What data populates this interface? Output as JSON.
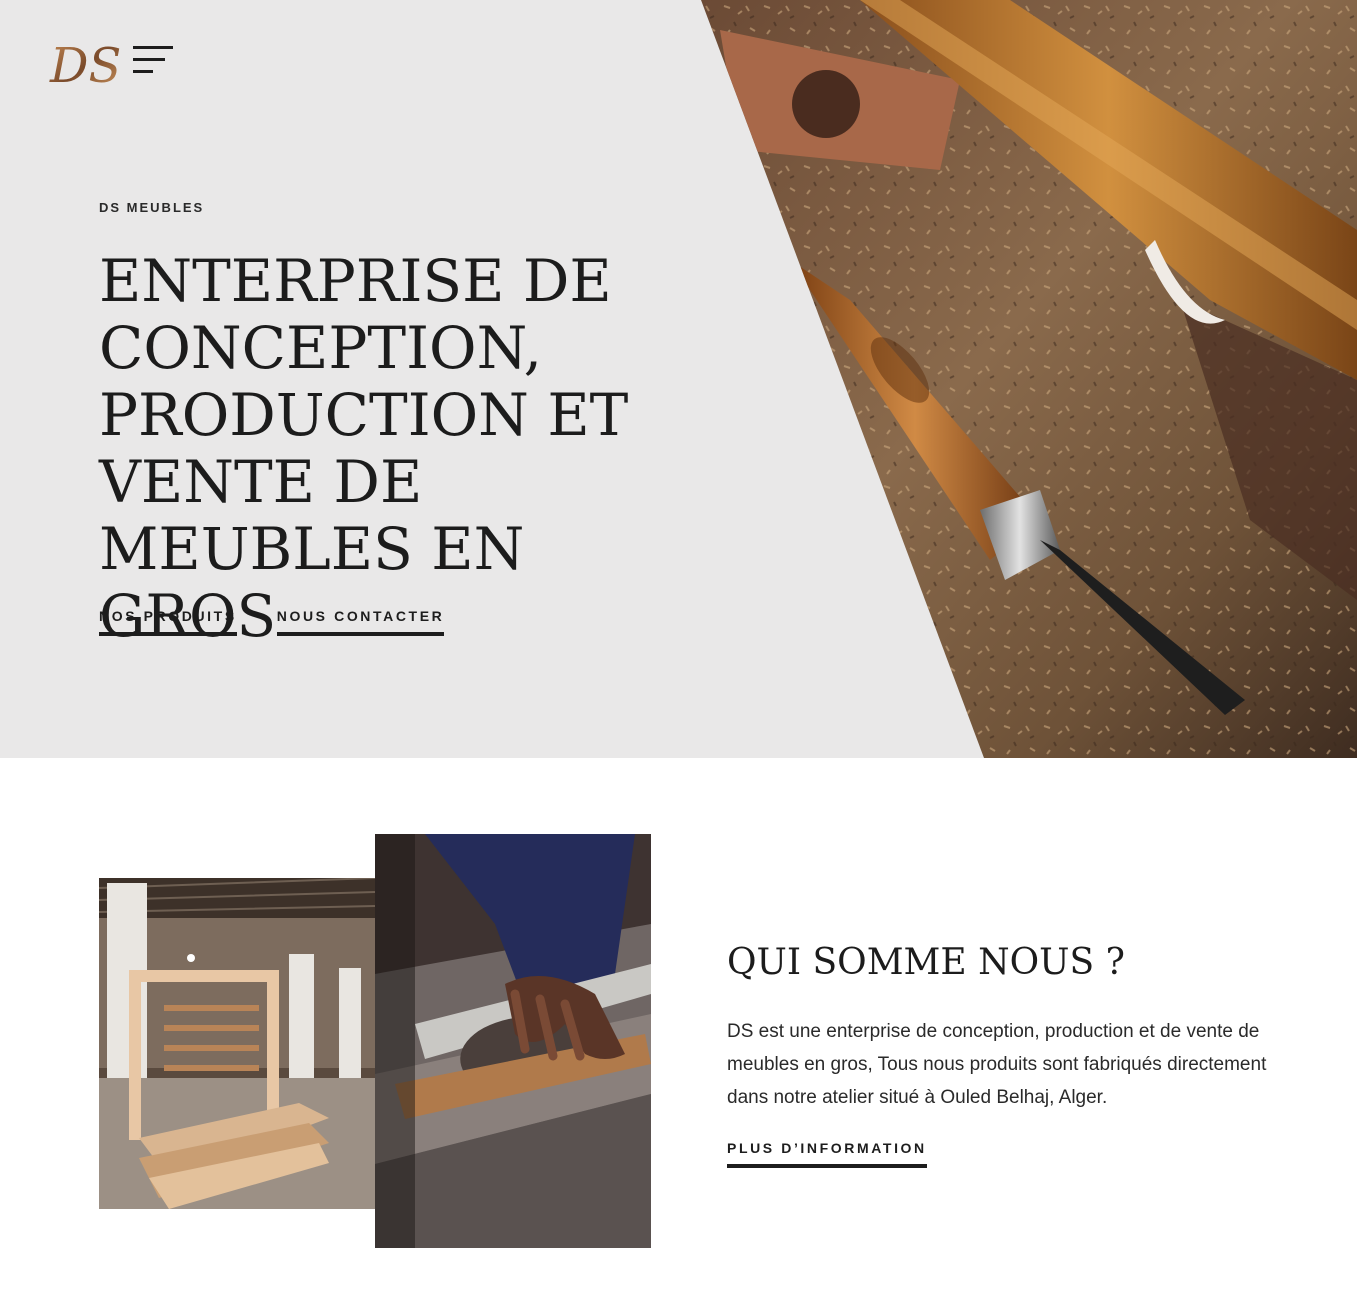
{
  "brand": {
    "logo_text": "DS",
    "menu_icon": "hamburger-menu-icon"
  },
  "hero": {
    "eyebrow": "DS MEUBLES",
    "title": "ENTERPRISE DE CONCEPTION, PRODUCTION ET VENTE DE MEUBLES EN GROS",
    "links": [
      {
        "label": "NOS PRODUITS"
      },
      {
        "label": "NOUS CONTACTER"
      }
    ],
    "image": "wood-chisel-sawdust-photo",
    "background": "#e9e8e8"
  },
  "about": {
    "title": "QUI SOMME NOUS ?",
    "text": "DS est une enterprise de conception, production et de vente de meubles en gros, Tous nous produits sont fabriqués directement dans notre atelier situé à Ouled Belhaj, Alger.",
    "link_label": "PLUS D’INFORMATION",
    "images": [
      "workshop-furniture-frames-photo",
      "table-saw-hand-photo"
    ]
  },
  "colors": {
    "text": "#1d1d1d",
    "hero_bg": "#e9e8e8",
    "wood": "#b8773a"
  }
}
